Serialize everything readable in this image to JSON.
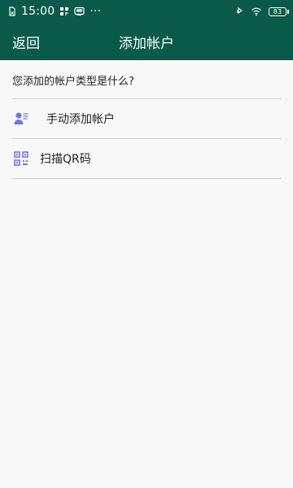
{
  "status_bar": {
    "time": "15:00",
    "dots": "···",
    "battery": "83"
  },
  "header": {
    "back_label": "返回",
    "title": "添加帐户"
  },
  "question": {
    "text": "您添加的帐户类型是什么?"
  },
  "options": [
    {
      "label": "手动添加帐户",
      "icon": "person-list-icon"
    },
    {
      "label": "扫描QR码",
      "icon": "qr-code-icon"
    }
  ],
  "colors": {
    "header_bg": "#0a5a4a",
    "page_bg": "#f8f8f8",
    "icon_accent": "#6f74e8"
  }
}
